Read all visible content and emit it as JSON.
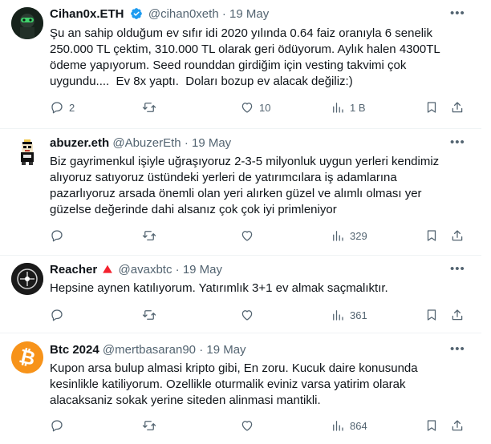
{
  "tweets": [
    {
      "name": "Cihan0x.ETH",
      "handle": "@cihan0xeth",
      "sep": "·",
      "date": "19 May",
      "text": "Şu an sahip olduğum ev sıfır idi 2020 yılında 0.64 faiz oranıyla 6 senelik\n250.000 TL çektim, 310.000 TL olarak geri ödüyorum. Aylık halen 4300TL\nödeme yapıyorum. Seed rounddan girdiğim için vesting takvimi çok\nuygundu....  Ev 8x yaptı.  Doları bozup ev alacak değiliz:)",
      "replies": "2",
      "retweets": "",
      "likes": "10",
      "views": "1 B",
      "verified": true
    },
    {
      "name": "abuzer.eth",
      "handle": "@AbuzerEth",
      "sep": "·",
      "date": "19 May",
      "text": "Biz gayrimenkul işiyle uğraşıyoruz 2-3-5 milyonluk uygun yerleri kendimiz\nalıyoruz satıyoruz üstündeki yerleri de yatırımcılara iş adamlarına\npazarlıyoruz arsada önemli olan yeri alırken güzel ve alımlı olması yer\ngüzelse değerinde dahi alsanız çok çok iyi primleniyor",
      "replies": "",
      "retweets": "",
      "likes": "",
      "views": "329"
    },
    {
      "name": "Reacher",
      "handle": "@avaxbtc",
      "sep": "·",
      "date": "19 May",
      "text": "Hepsine aynen katılıyorum. Yatırımlık 3+1 ev almak saçmalıktır.",
      "replies": "",
      "retweets": "",
      "likes": "",
      "views": "361"
    },
    {
      "name": "Btc 2024",
      "handle": "@mertbasaran90",
      "sep": "·",
      "date": "19 May",
      "text": "Kupon arsa bulup almasi kripto gibi, En zoru. Kucuk daire konusunda\nkesinlikle katiliyorum. Ozellikle oturmalik eviniz varsa yatirim olarak\nalacaksaniz sokak yerine siteden alinmasi mantikli.",
      "replies": "",
      "retweets": "",
      "likes": "",
      "views": "864"
    }
  ],
  "colors": {
    "text": "#0f1419",
    "secondary": "#536471",
    "verified": "#1d9bf0",
    "reacher_badge": "#f4212e",
    "bitcoin": "#f7931a"
  },
  "icons": [
    "more-icon",
    "reply-icon",
    "retweet-icon",
    "like-icon",
    "views-icon",
    "bookmark-icon",
    "share-icon",
    "verified-icon",
    "warning-triangle-icon",
    "bitcoin-logo-icon"
  ]
}
